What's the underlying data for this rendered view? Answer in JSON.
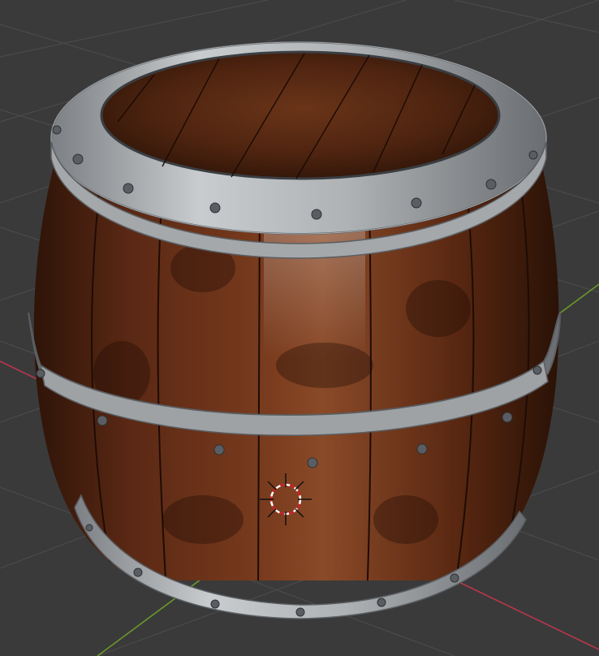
{
  "viewport": {
    "background_color": "#3a3a3a",
    "grid_color": "#4a4a4a",
    "x_axis_color": "#b8364a",
    "y_axis_color": "#6a9a2a"
  },
  "object": {
    "kind": "wooden-barrel",
    "wood_color": "#5a2a14",
    "metal_color": "#b8bcbe",
    "rivet_color": "#5a5e62"
  },
  "cursor_3d": {
    "ring_color_a": "#d0202a",
    "ring_color_b": "#ffffff"
  }
}
